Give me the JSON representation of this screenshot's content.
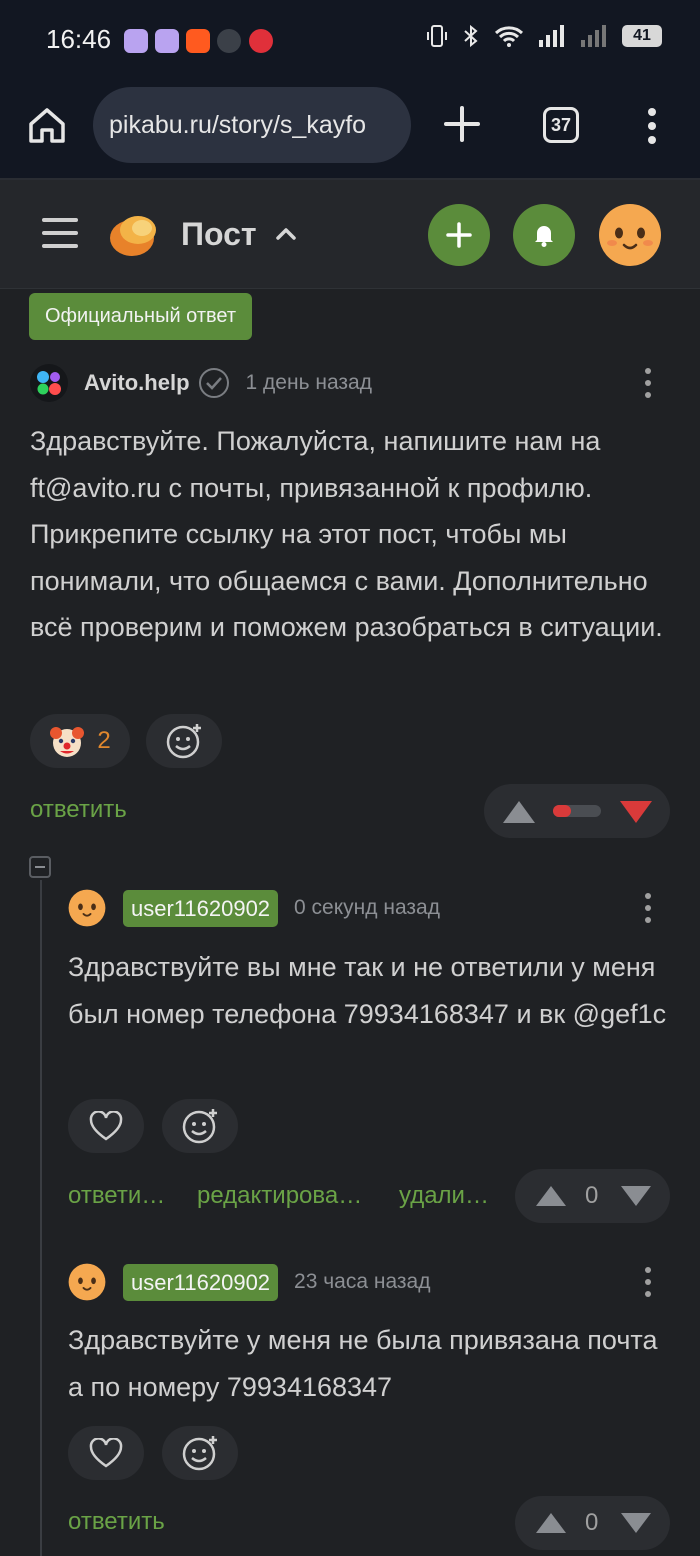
{
  "status_bar": {
    "time": "16:46",
    "battery": "41"
  },
  "browser": {
    "url": "pikabu.ru/story/s_kayfo",
    "tab_count": "37"
  },
  "header": {
    "title": "Пост"
  },
  "official_comment": {
    "badge": "Официальный ответ",
    "author": "Avito.help",
    "time": "1 день назад",
    "text": "Здравствуйте. Пожалуйста, напишите нам на ft@avito.ru с почты, привязанной к профилю. Прикрепите ссылку на этот пост, чтобы мы понимали, что общаемся с вами. Дополнительно всё проверим и поможем разобраться в ситуации.",
    "reaction_count": "2",
    "reply": "ответить"
  },
  "reply1": {
    "author": "user11620902",
    "time": "0 секунд назад",
    "text": "Здравствуйте вы мне так и не ответили у меня был номер телефона 79934168347 и вк @gef1c",
    "reply": "ответи…",
    "edit": "редактирова…",
    "delete": "удали…",
    "votes": "0"
  },
  "reply2": {
    "author": "user11620902",
    "time": "23 часа назад",
    "text": "Здравствуйте у меня не была привязана почта а по номеру 79934168347",
    "reply": "ответить",
    "votes": "0"
  },
  "colors": {
    "accent": "#5b8c3b",
    "link": "#6aa346",
    "downvote": "#d93a3a"
  }
}
